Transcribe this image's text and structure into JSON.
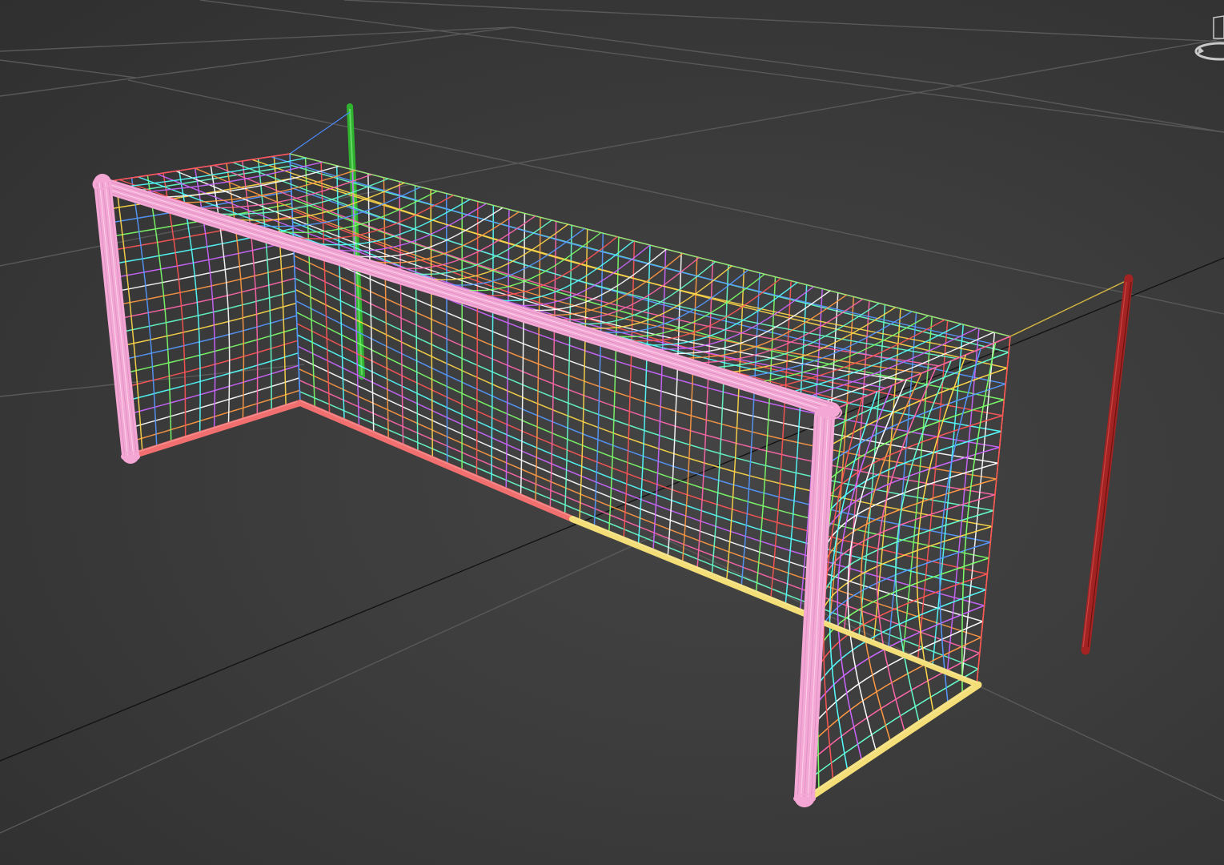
{
  "viewport": {
    "background": "#3e3e3e",
    "grid_color": "#595959",
    "world_axis_color": "#111111"
  },
  "viewcube": {
    "icon": "viewcube-icon",
    "color": "#bdbdbd"
  },
  "scene_objects": [
    {
      "name": "goal-frame",
      "type": "wireframe-mesh",
      "color": "#f4a6d4"
    },
    {
      "name": "goal-base-bar-left",
      "type": "wireframe-mesh",
      "color": "#f16f6f"
    },
    {
      "name": "goal-base-bar-right",
      "type": "wireframe-mesh",
      "color": "#f3de78"
    },
    {
      "name": "goal-net",
      "type": "wireframe-mesh",
      "colors": [
        "#ff66aa",
        "#66ffcc",
        "#ffd84a",
        "#5599ff",
        "#7dff6a",
        "#ff5555",
        "#55ffff",
        "#cc66ff",
        "#ffffff",
        "#ff9944"
      ]
    },
    {
      "name": "net-support-pole-back",
      "type": "wireframe-mesh",
      "color": "#2fb32f"
    },
    {
      "name": "net-support-pole-right",
      "type": "wireframe-mesh",
      "color": "#a32323"
    }
  ]
}
